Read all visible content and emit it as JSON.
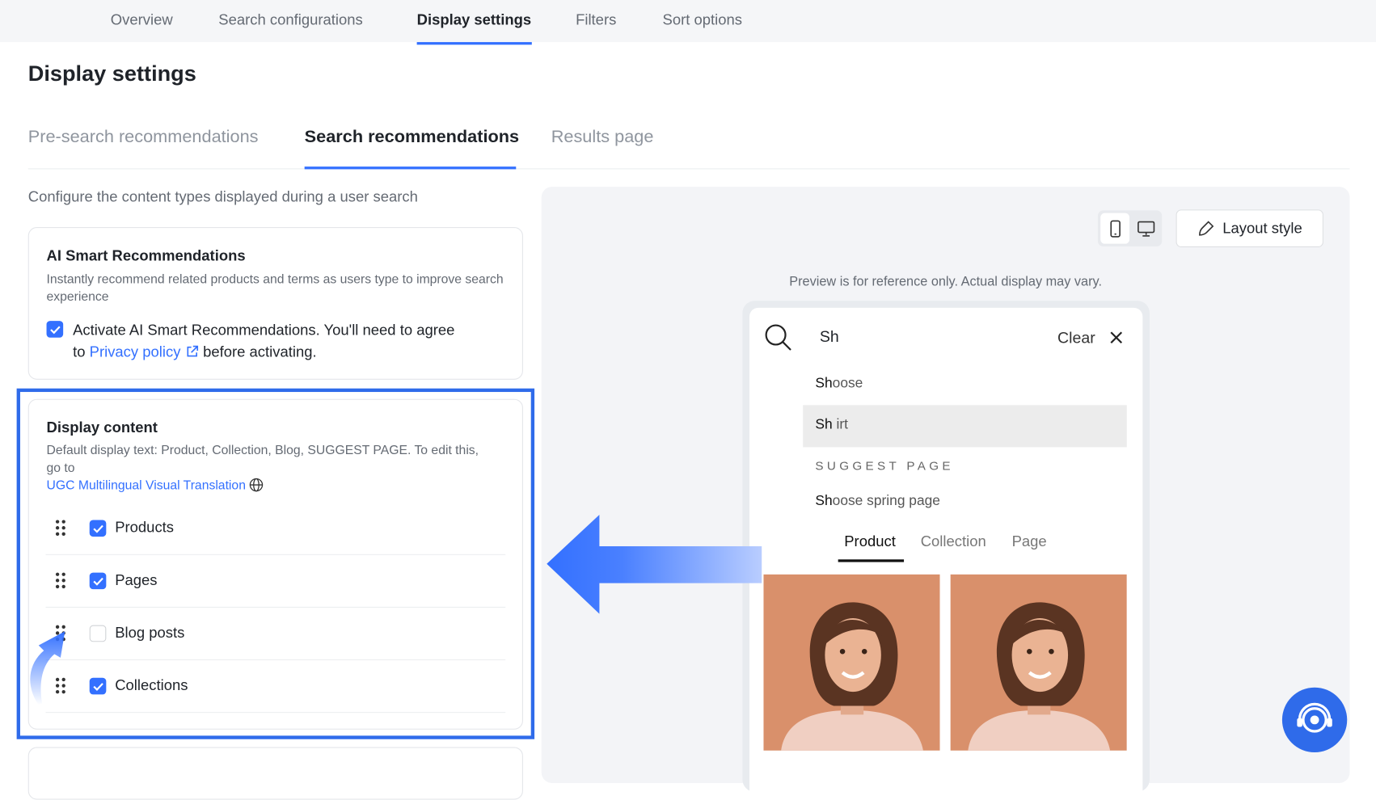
{
  "top_nav": {
    "tabs": [
      {
        "label": "Overview",
        "active": false
      },
      {
        "label": "Search configurations",
        "active": false
      },
      {
        "label": "Display settings",
        "active": true
      },
      {
        "label": "Filters",
        "active": false
      },
      {
        "label": "Sort options",
        "active": false
      }
    ]
  },
  "page_title": "Display settings",
  "sub_tabs": [
    {
      "label": "Pre-search recommendations",
      "active": false
    },
    {
      "label": "Search recommendations",
      "active": true
    },
    {
      "label": "Results page",
      "active": false
    }
  ],
  "intro": "Configure the content types displayed during a user search",
  "ai_card": {
    "title": "AI Smart Recommendations",
    "description": "Instantly recommend related products and terms as users type to improve search experience",
    "checkbox_text_1": "Activate AI Smart Recommendations. You'll need to agree",
    "checkbox_text_2": "to",
    "link": "Privacy policy",
    "checkbox_text_3": "before activating.",
    "checked": true
  },
  "display_card": {
    "title": "Display content",
    "description": "Default display text: Product, Collection, Blog, SUGGEST PAGE. To edit this, go to",
    "link": "UGC Multilingual Visual Translation",
    "items": [
      {
        "label": "Products",
        "checked": true
      },
      {
        "label": "Pages",
        "checked": true
      },
      {
        "label": "Blog posts",
        "checked": false
      },
      {
        "label": "Collections",
        "checked": true
      }
    ]
  },
  "preview": {
    "layout_button": "Layout style",
    "note": "Preview is for reference only. Actual display may vary.",
    "query": "Sh",
    "clear": "Clear",
    "suggestions": [
      {
        "match": "Sh",
        "rest": "oose"
      },
      {
        "match": "Sh",
        "rest": " irt"
      }
    ],
    "suggest_page_heading": "SUGGEST PAGE",
    "page_suggestion": {
      "match": "Sh",
      "rest": "oose spring page"
    },
    "tabs": [
      {
        "label": "Product",
        "active": true
      },
      {
        "label": "Collection",
        "active": false
      },
      {
        "label": "Page",
        "active": false
      }
    ]
  },
  "colors": {
    "accent": "#3370ff",
    "highlight": "#2f6bea",
    "image_bg": "#d9906b"
  }
}
